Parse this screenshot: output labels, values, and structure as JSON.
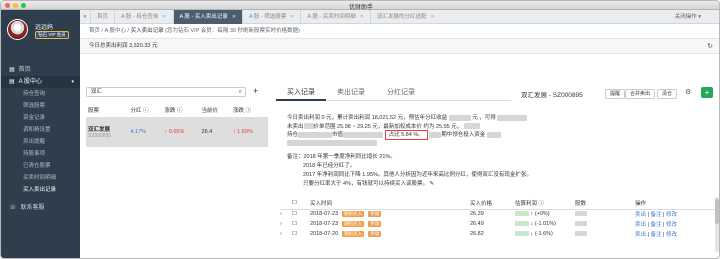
{
  "window": {
    "title": "优财助手"
  },
  "user": {
    "name": "远远妈",
    "vip": "钻石 VIP 会员"
  },
  "nav": {
    "home": "首页",
    "a_share_center": "A 股中心",
    "subs": [
      "持仓查询",
      "筛选股票",
      "资金记录",
      "调和精设置",
      "卖出提醒",
      "持股事项",
      "已清仓股票",
      "买卖时间明细",
      "买入卖出记录"
    ],
    "contact": "联系客服"
  },
  "tabs": [
    {
      "label": "首页"
    },
    {
      "label": "A 股 - 持仓查询"
    },
    {
      "label": "A 股 - 买入卖出记录"
    },
    {
      "label": "A 股 - 筛选股票"
    },
    {
      "label": "A 股 - 买卖时间明细"
    },
    {
      "label": "双汇发展的分红送配"
    }
  ],
  "tab_ops": "关闭操作",
  "breadcrumb": {
    "home": "首页",
    "center": "A 股中心",
    "page": "买入卖出记录",
    "note": "(您为钻石 VIP 会员：每隔 30 秒刷新股票实时价格数据)"
  },
  "today_sell": "今日总卖出利润 3,320.33 元",
  "search": {
    "value": "双汇"
  },
  "stock_table": {
    "headers": [
      "股票",
      "分红",
      "涨跌",
      "当前价",
      "涨跌"
    ],
    "row": {
      "name": "双汇发展",
      "code": "SZ000895",
      "dividend": "4.17%",
      "change": "0.65%",
      "price": "26.4",
      "change2": "1.69%"
    }
  },
  "right_tabs": [
    "买入记录",
    "卖出记录",
    "分红记录"
  ],
  "stock_title": "双汇发展 - SZ000895",
  "buttons": {
    "alert": "提醒",
    "merge": "合并卖出",
    "clear": "清仓"
  },
  "info": {
    "line1a": "今日卖出利润 0 元，累计卖出利润 18,021.52 元，预估年分红收益",
    "line1b": "元 ，可得",
    "line2a": "未卖出",
    "line2b": "价单范围 25.98 ~ 29.25 元，最新加权成本价 约为 25.95 元，",
    "line3a": "持仓",
    "line3b": "市值",
    "highlight": "占比 5.84 %。",
    "line3c": "期中领仓投入资金",
    "line4": "备注：2018 年第一季度净利同比增长 21%。",
    "line5": "2018 年已经分红了。",
    "line6": "2017 年净利润同比下降 1.95%。其他人分析因为近年来高比例分红，使得双汇没有现金扩张。",
    "line7": "只要分红率大于 4%，有钱就可以持续买入该股票。"
  },
  "trade_table": {
    "headers": [
      "买入时间",
      "买入价格",
      "估算利润",
      "股数",
      "操作"
    ],
    "rows": [
      {
        "date": "2018-07-23",
        "tag1": "期初买入",
        "tag2": "手动",
        "price": "26.39",
        "profit": "(+0%)",
        "ops": [
          "卖出",
          "备注",
          "修改"
        ]
      },
      {
        "date": "2018-07-23",
        "tag1": "期初买入",
        "tag2": "手动",
        "price": "26.49",
        "profit": "(-1.01%)",
        "ops": [
          "卖出",
          "备注",
          "修改"
        ]
      },
      {
        "date": "2018-07-20",
        "tag1": "期初买入",
        "tag2": "手动",
        "price": "26.82",
        "profit": "(-1.6%)",
        "ops": [
          "卖出",
          "备注",
          "修改"
        ]
      }
    ]
  }
}
